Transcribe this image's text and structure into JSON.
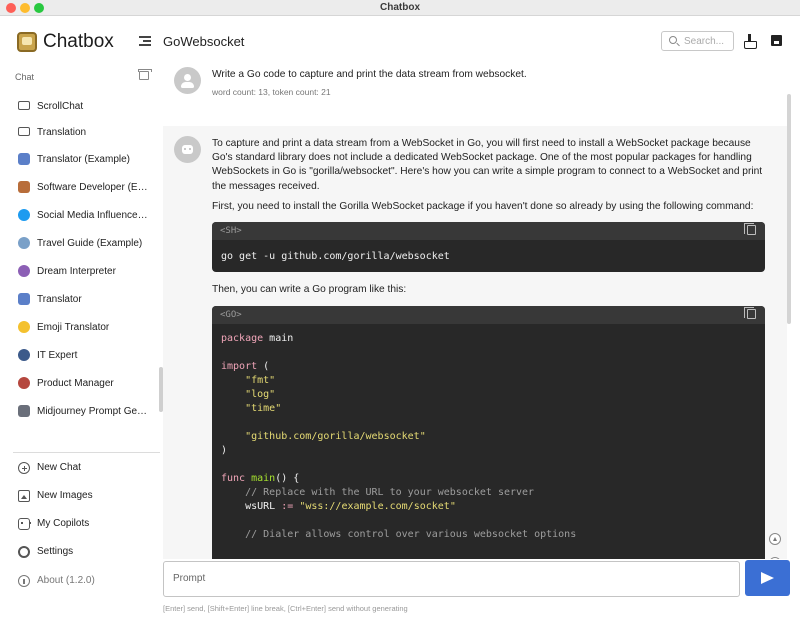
{
  "window": {
    "title": "Chatbox"
  },
  "brand": {
    "name": "Chatbox"
  },
  "sidebar": {
    "section_label": "Chat",
    "sessions": [
      {
        "label": "ScrollChat",
        "icon": "chat-bubble-icon"
      },
      {
        "label": "Translation",
        "icon": "chat-bubble-icon"
      },
      {
        "label": "Translator (Example)",
        "icon": "translator-avatar-icon"
      },
      {
        "label": "Software Developer (Example)",
        "icon": "developer-avatar-icon"
      },
      {
        "label": "Social Media Influencer (Example)",
        "icon": "twitter-avatar-icon"
      },
      {
        "label": "Travel Guide (Example)",
        "icon": "globe-avatar-icon"
      },
      {
        "label": "Dream Interpreter",
        "icon": "dream-avatar-icon"
      },
      {
        "label": "Translator",
        "icon": "translator-avatar-icon"
      },
      {
        "label": "Emoji Translator",
        "icon": "emoji-avatar-icon"
      },
      {
        "label": "IT Expert",
        "icon": "it-avatar-icon"
      },
      {
        "label": "Product Manager",
        "icon": "person-avatar-icon"
      },
      {
        "label": "Midjourney Prompt Generator",
        "icon": "midjourney-avatar-icon"
      }
    ],
    "menu": {
      "new_chat": "New Chat",
      "new_images": "New Images",
      "my_copilots": "My Copilots",
      "settings": "Settings",
      "about": "About (1.2.0)"
    }
  },
  "header": {
    "title": "GoWebsocket",
    "search_placeholder": "Search..."
  },
  "messages": {
    "user": {
      "text": "Write a Go code to capture and print the data stream from websocket.",
      "stats": "word count: 13, token count: 21"
    },
    "assistant": {
      "intro": "To capture and print a data stream from a WebSocket in Go, you will first need to install a WebSocket package because Go's standard library does not include a dedicated WebSocket package. One of the most popular packages for handling WebSockets in Go is \"gorilla/websocket\". Here's how you can write a simple program to connect to a WebSocket and print the messages received.",
      "install_note": "First, you need to install the Gorilla WebSocket package if you haven't done so already by using the following command:",
      "install_lang": "<SH>",
      "install_cmd": "go get -u github.com/gorilla/websocket",
      "program_note": "Then, you can write a Go program like this:",
      "program_lang": "<GO>",
      "code": {
        "kw_package": "package",
        "pkg_name": " main",
        "kw_import": "import",
        "import_open": " (",
        "imp1": "\"fmt\"",
        "imp2": "\"log\"",
        "imp3": "\"time\"",
        "imp4": "\"github.com/gorilla/websocket\"",
        "import_close": ")",
        "kw_func": "func",
        "fn_main": "main",
        "fn_sig": "() {",
        "comment1": "// Replace with the URL to your websocket server",
        "var_ws": "wsURL",
        "op_assign": ":=",
        "ws_value": "\"wss://example.com/socket\"",
        "comment2": "// Dialer allows control over various websocket options"
      }
    }
  },
  "composer": {
    "placeholder": "Prompt",
    "hint": "[Enter] send, [Shift+Enter] line break, [Ctrl+Enter] send without generating"
  },
  "colors": {
    "accent": "#3b6fd4",
    "code_bg": "#282828",
    "keyword": "#f0a5b8",
    "string": "#e6db74",
    "function": "#a6e22e"
  }
}
